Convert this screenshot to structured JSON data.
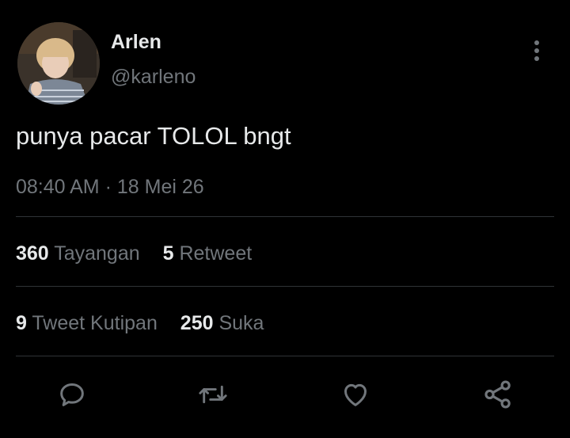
{
  "user": {
    "display_name": "Arlen",
    "handle": "@karleno",
    "avatar": "user-photo"
  },
  "tweet": {
    "text": "punya pacar TOLOL bngt",
    "time": "08:40 AM",
    "separator": "·",
    "date": "18 Mei 26"
  },
  "stats": {
    "views": {
      "count": "360",
      "label": "Tayangan"
    },
    "retweets": {
      "count": "5",
      "label": "Retweet"
    },
    "quotes": {
      "count": "9",
      "label": "Tweet Kutipan"
    },
    "likes": {
      "count": "250",
      "label": "Suka"
    }
  },
  "actions": [
    "reply-icon",
    "retweet-icon",
    "like-icon",
    "share-icon"
  ],
  "colors": {
    "background": "#000000",
    "text_primary": "#e7e9ea",
    "text_secondary": "#71767b",
    "divider": "#2f3336"
  }
}
